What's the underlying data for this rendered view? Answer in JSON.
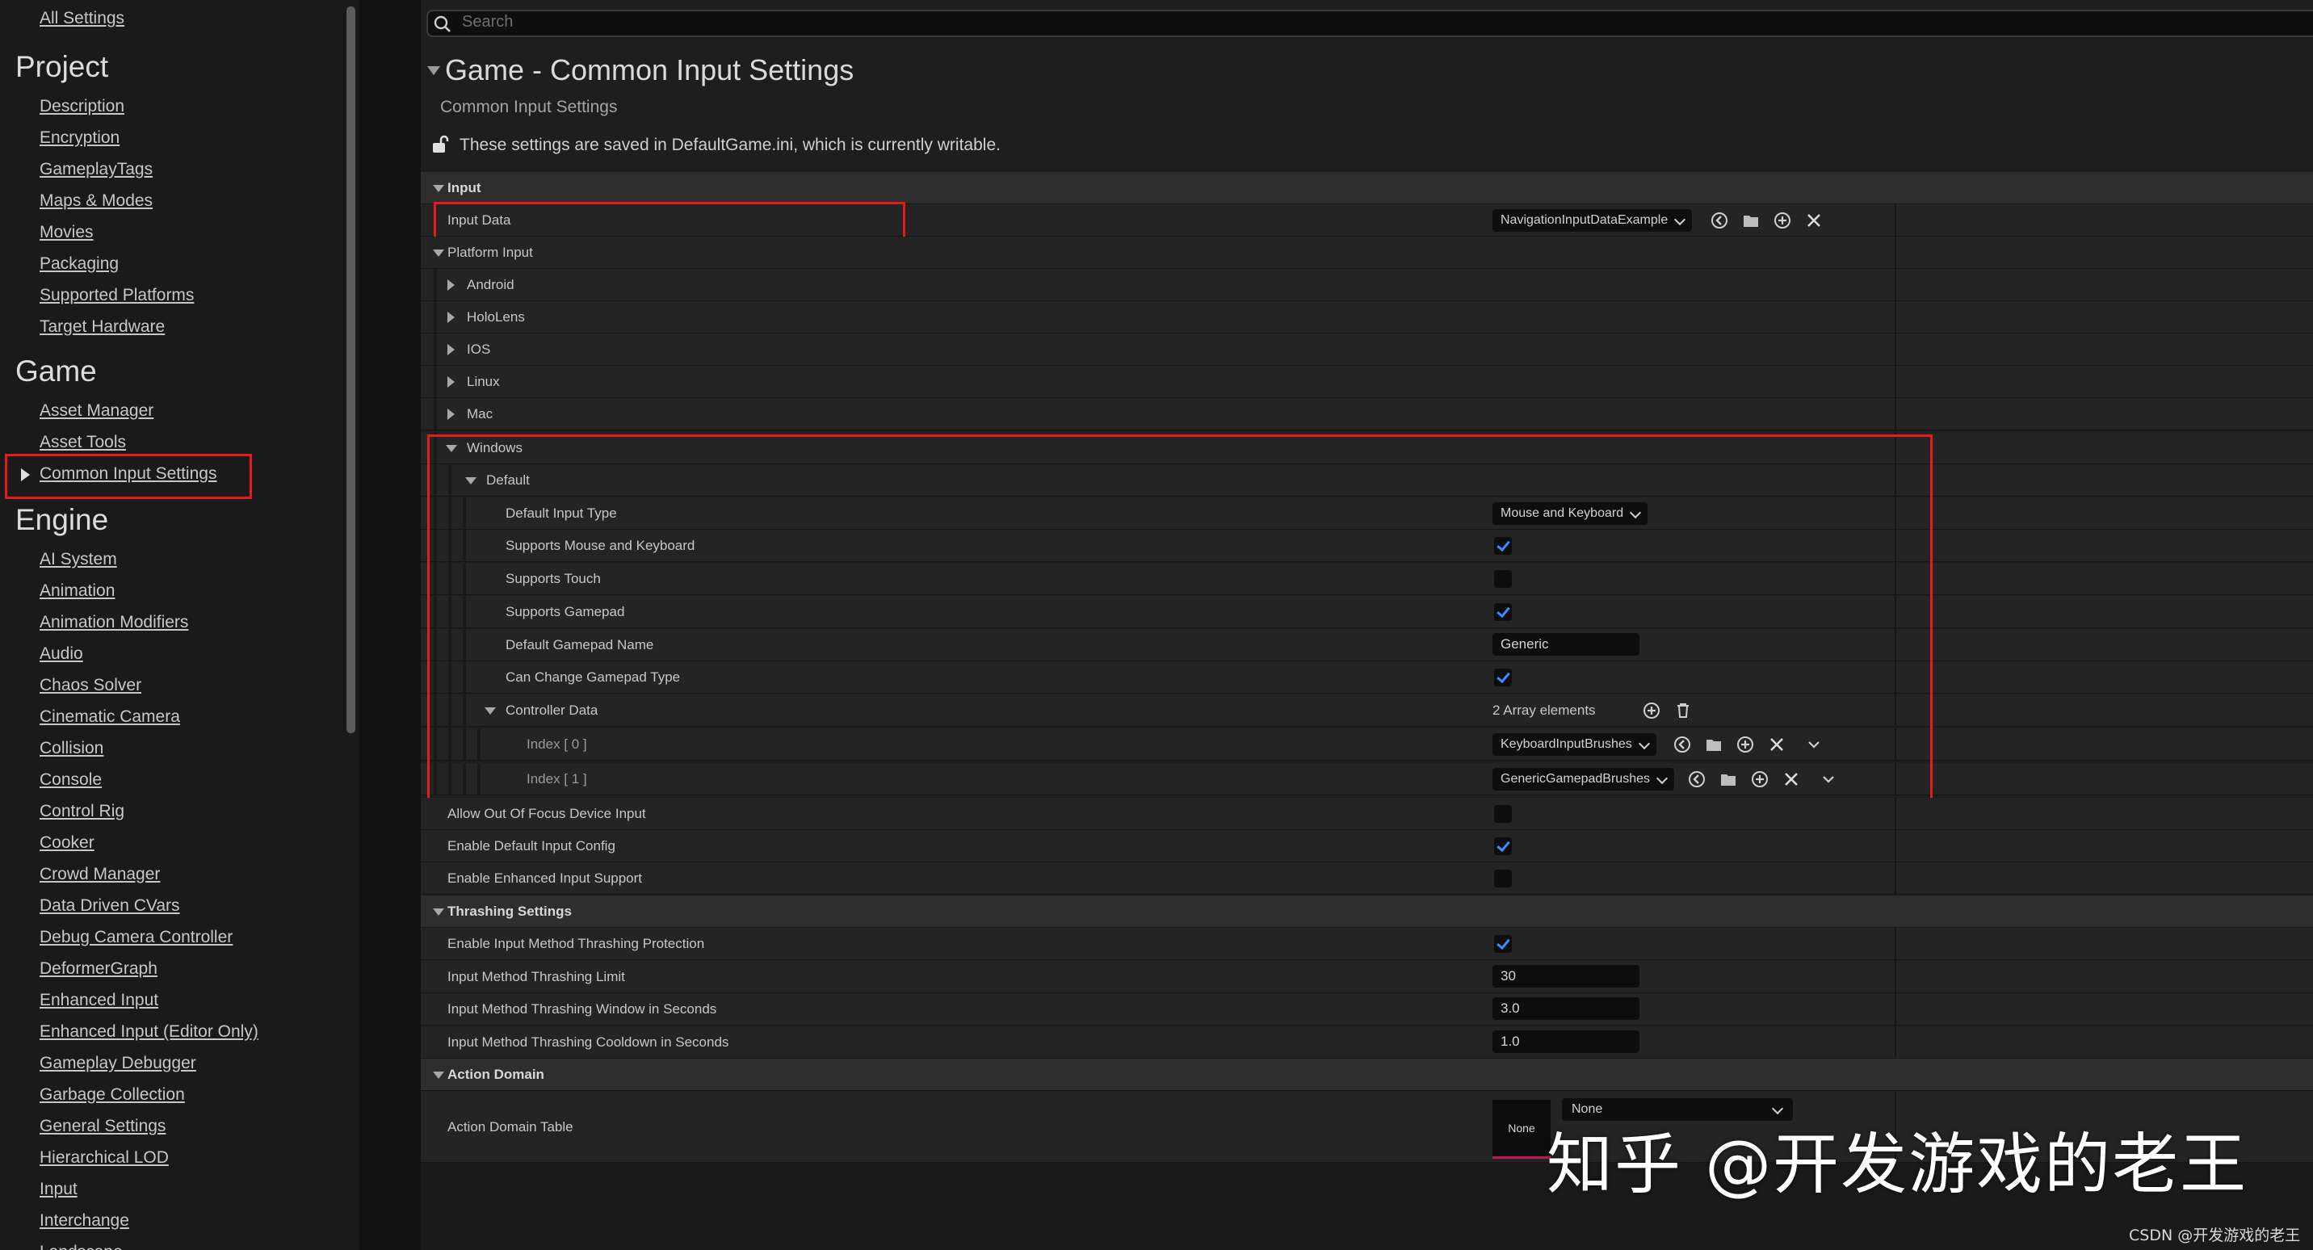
{
  "sidebar": {
    "top_link": "All Settings",
    "sections": [
      {
        "heading": "Project",
        "items": [
          "Description",
          "Encryption",
          "GameplayTags",
          "Maps & Modes",
          "Movies",
          "Packaging",
          "Supported Platforms",
          "Target Hardware"
        ]
      },
      {
        "heading": "Game",
        "items": [
          "Asset Manager",
          "Asset Tools",
          "Common Input Settings"
        ]
      },
      {
        "heading": "Engine",
        "items": [
          "AI System",
          "Animation",
          "Animation Modifiers",
          "Audio",
          "Chaos Solver",
          "Cinematic Camera",
          "Collision",
          "Console",
          "Control Rig",
          "Cooker",
          "Crowd Manager",
          "Data Driven CVars",
          "Debug Camera Controller",
          "DeformerGraph",
          "Enhanced Input",
          "Enhanced Input (Editor Only)",
          "Gameplay Debugger",
          "Garbage Collection",
          "General Settings",
          "Hierarchical LOD",
          "Input",
          "Interchange",
          "Landscape"
        ]
      }
    ],
    "selected": "Common Input Settings"
  },
  "search": {
    "placeholder": "Search"
  },
  "header": {
    "title": "Game - Common Input Settings",
    "subtitle": "Common Input Settings",
    "info": "These settings are saved in DefaultGame.ini, which is currently writable."
  },
  "props": {
    "input_cat": "Input",
    "input_data": {
      "label": "Input Data",
      "value": "NavigationInputDataExample"
    },
    "platform_input": "Platform Input",
    "platforms": [
      "Android",
      "HoloLens",
      "IOS",
      "Linux",
      "Mac"
    ],
    "windows": "Windows",
    "default": "Default",
    "default_input_type": {
      "label": "Default Input Type",
      "value": "Mouse and Keyboard"
    },
    "supports_mk": {
      "label": "Supports Mouse and Keyboard",
      "checked": true
    },
    "supports_touch": {
      "label": "Supports Touch",
      "checked": false
    },
    "supports_gamepad": {
      "label": "Supports Gamepad",
      "checked": true
    },
    "default_gamepad_name": {
      "label": "Default Gamepad Name",
      "value": "Generic"
    },
    "can_change_gamepad": {
      "label": "Can Change Gamepad Type",
      "checked": true
    },
    "controller_data": {
      "label": "Controller Data",
      "count": "2 Array elements"
    },
    "index0": {
      "label": "Index [ 0 ]",
      "value": "KeyboardInputBrushes"
    },
    "index1": {
      "label": "Index [ 1 ]",
      "value": "GenericGamepadBrushes"
    },
    "allow_oof": {
      "label": "Allow Out Of Focus Device Input",
      "checked": false
    },
    "enable_default_cfg": {
      "label": "Enable Default Input Config",
      "checked": true
    },
    "enable_enhanced": {
      "label": "Enable Enhanced Input Support",
      "checked": false
    },
    "thrashing_cat": "Thrashing Settings",
    "thrash_protect": {
      "label": "Enable Input Method Thrashing Protection",
      "checked": true
    },
    "thrash_limit": {
      "label": "Input Method Thrashing Limit",
      "value": "30"
    },
    "thrash_window": {
      "label": "Input Method Thrashing Window in Seconds",
      "value": "3.0"
    },
    "thrash_cooldown": {
      "label": "Input Method Thrashing Cooldown in Seconds",
      "value": "1.0"
    },
    "action_domain_cat": "Action Domain",
    "action_domain_table": {
      "label": "Action Domain Table",
      "thumb": "None",
      "value": "None"
    }
  },
  "overlay": {
    "watermark": "知乎 @开发游戏的老王",
    "credit": "CSDN @开发游戏的老王"
  },
  "colors": {
    "highlight_box": "#e21b1b",
    "check": "#3c8cff",
    "accent_bar": "#c2185b"
  },
  "icons": [
    "search-icon",
    "unlock-icon",
    "browse-icon",
    "folder-icon",
    "add-icon",
    "clear-icon",
    "delete-icon",
    "chevron-down-icon"
  ]
}
